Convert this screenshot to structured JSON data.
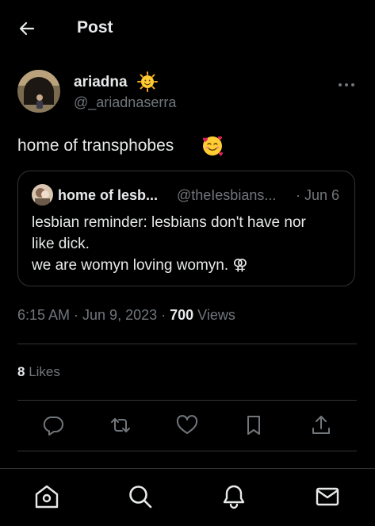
{
  "header": {
    "title": "Post"
  },
  "author": {
    "name": "ariadna",
    "handle": "@_ariadnaserra"
  },
  "post": {
    "text": "home of transphobes"
  },
  "quote": {
    "name": "home of lesb...",
    "handle": "@theIesbians...",
    "date": "· Jun 6",
    "lines": [
      "lesbian reminder: lesbians don't have nor",
      "like dick.",
      "we are womyn loving womyn. ⚢"
    ]
  },
  "meta": {
    "time": "6:15 AM · Jun 9, 2023 · ",
    "views_count": "700",
    "views_label": " Views"
  },
  "stats": {
    "likes_count": "8",
    "likes_label": " Likes"
  },
  "actions": [
    "reply-icon",
    "repost-icon",
    "like-icon",
    "bookmark-icon",
    "share-icon"
  ],
  "nav": [
    "home-icon",
    "search-icon",
    "notifications-icon",
    "messages-icon"
  ],
  "colors": {
    "background": "#000000",
    "text": "#e7e9ea",
    "secondary": "#71767b",
    "border": "#2f3336"
  }
}
